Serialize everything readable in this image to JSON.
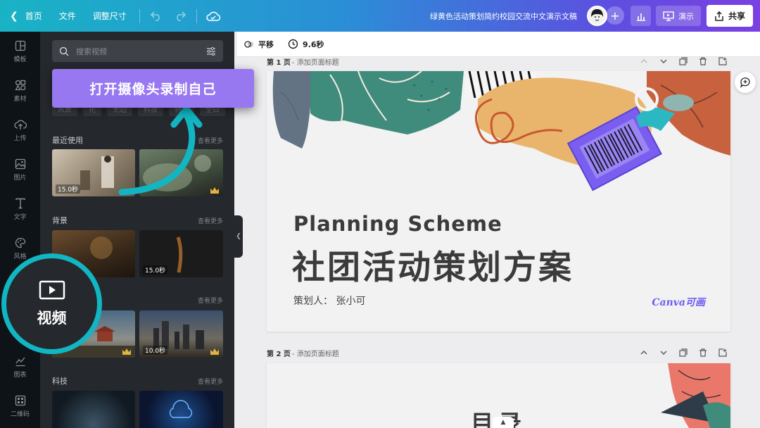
{
  "topbar": {
    "home_label": "首页",
    "file_label": "文件",
    "resize_label": "调整尺寸",
    "doc_title": "绿黄色活动策划简约校园交流中文演示文稿",
    "present_label": "演示",
    "share_label": "共享"
  },
  "rail": {
    "items": [
      {
        "label": "模板",
        "icon": "layout-icon"
      },
      {
        "label": "素材",
        "icon": "shapes-icon"
      },
      {
        "label": "上传",
        "icon": "upload-icon"
      },
      {
        "label": "图片",
        "icon": "image-icon"
      },
      {
        "label": "文字",
        "icon": "text-icon"
      },
      {
        "label": "风格",
        "icon": "palette-icon"
      },
      {
        "label": "图表",
        "icon": "chart-icon"
      },
      {
        "label": "二维码",
        "icon": "qr-icon"
      }
    ]
  },
  "panel": {
    "search_placeholder": "搜索视频",
    "chips": [
      "风景",
      "花",
      "无边",
      "科技",
      "特红",
      "全白"
    ],
    "sections": {
      "recent": {
        "title": "最近使用",
        "more": "查看更多"
      },
      "background": {
        "title": "背景",
        "more": "查看更多"
      },
      "third": {
        "more": "查看更多"
      },
      "tech": {
        "title": "科技",
        "more": "查看更多"
      }
    },
    "durations": {
      "recent1": "15.0秒",
      "bg2": "15.0秒",
      "city2": "10.0秒"
    }
  },
  "overlay": {
    "camera_button": "打开摄像头录制自己",
    "video_label": "视频"
  },
  "canvas_bar": {
    "transition_label": "平移",
    "duration_label": "9.6秒"
  },
  "pages": [
    {
      "number": "第 1 页",
      "title": "- 添加页面标题"
    },
    {
      "number": "第 2 页",
      "title": "- 添加页面标题"
    }
  ],
  "slide1": {
    "title_en": "Planning Scheme",
    "title_cn": "社团活动策划方案",
    "author": "策划人：  张小可",
    "brand": "Canva可画"
  },
  "slide2": {
    "partial_text": "目录"
  },
  "colors": {
    "accent_teal": "#12b6c3",
    "accent_purple": "#9878f0",
    "panel_bg": "#25282d"
  }
}
